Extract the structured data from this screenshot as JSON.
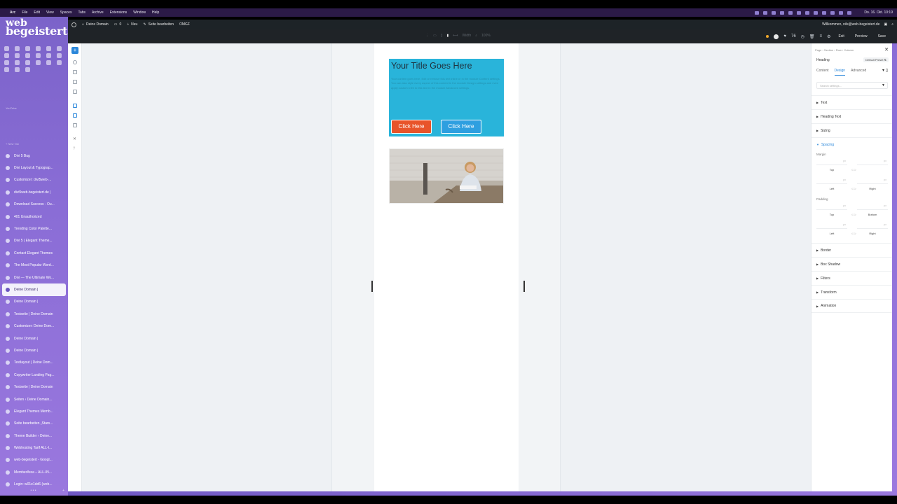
{
  "menubar": {
    "app": "Arc",
    "items": [
      "File",
      "Edit",
      "View",
      "Spaces",
      "Tabs",
      "Archive",
      "Extensions",
      "Window",
      "Help"
    ],
    "clock": "Do. 16. Okt. 10:19"
  },
  "sidebar": {
    "logo_line1": "web",
    "logo_line2": "begeistert.de",
    "section_label": "YouTube",
    "new_tab": "+ New Tab",
    "tabs": [
      {
        "label": "Divi 5 Bug"
      },
      {
        "label": "Divi Layout & Typograp..."
      },
      {
        "label": "Customizer: divi5web-..."
      },
      {
        "label": "divi5web.begeistert.de |"
      },
      {
        "label": "Download Success - Ou..."
      },
      {
        "label": "401 Unauthorized"
      },
      {
        "label": "Trending Color Palette..."
      },
      {
        "label": "Divi 5 | Elegant Theme..."
      },
      {
        "label": "Contact Elegant Themes"
      },
      {
        "label": "The Most Popular Word..."
      },
      {
        "label": "Divi — The Ultimate Wo..."
      },
      {
        "label": "Deine Domain |",
        "active": true
      },
      {
        "label": "Deine Domain |"
      },
      {
        "label": "Testseite | Deine Domain"
      },
      {
        "label": "Customizer: Deine Dom..."
      },
      {
        "label": "Deine Domain |"
      },
      {
        "label": "Deine Domain |"
      },
      {
        "label": "Testlayout | Deine Dom..."
      },
      {
        "label": "Copywriter Landing Pag..."
      },
      {
        "label": "Testseite | Deine Domain"
      },
      {
        "label": "Seiten ‹ Deine Domain..."
      },
      {
        "label": "Elegant Themes Memb..."
      },
      {
        "label": "Seite bearbeiten „Stars..."
      },
      {
        "label": "Theme Builder ‹ Deine..."
      },
      {
        "label": "Webhosting Tarif ALL-I..."
      },
      {
        "label": "web-begeistert - Googl..."
      },
      {
        "label": "MemberArea – ALL-IN..."
      },
      {
        "label": "Login: w01e1dd6 (web..."
      }
    ]
  },
  "adminbar": {
    "site": "Deine Domain",
    "comments": "0",
    "new": "Neu",
    "edit": "Seite bearbeiten",
    "omgf": "OMGF",
    "welcome": "Willkommen, nils@web-begeistert.de"
  },
  "topbar": {
    "width_value": "Width",
    "zoom_value": "100%",
    "count": "76",
    "exit": "Exit",
    "preview": "Preview",
    "save": "Save"
  },
  "hero": {
    "title": "Your Title Goes Here",
    "body": "Your content goes here. Edit or remove this text inline or in the module Content settings. You can also style every aspect of this content in the module Design settings and even apply custom CSS to this text in the module Advanced settings.",
    "btn1": "Click Here",
    "btn2": "Click Here"
  },
  "panel": {
    "breadcrumb": "Page › Section › Row › Column",
    "module": "Heading",
    "preset": "Default Preset",
    "tabs": [
      "Content",
      "Design",
      "Advanced"
    ],
    "search_placeholder": "Search settings...",
    "groups_top": [
      "Text",
      "Heading Text",
      "Sizing"
    ],
    "spacing": "Spacing",
    "margin": "Margin",
    "padding": "Padding",
    "unit": "px",
    "top": "Top",
    "bottom": "Bottom",
    "left": "Left",
    "right": "Right",
    "groups_bottom": [
      "Border",
      "Box Shadow",
      "Filters",
      "Transform",
      "Animation"
    ]
  },
  "colors": {
    "accent": "#2b87da",
    "hero_bg": "#29b4da",
    "btn1": "#e8542a",
    "btn2": "#2e9fe0",
    "arc_sidebar": "#8a6dd6"
  }
}
